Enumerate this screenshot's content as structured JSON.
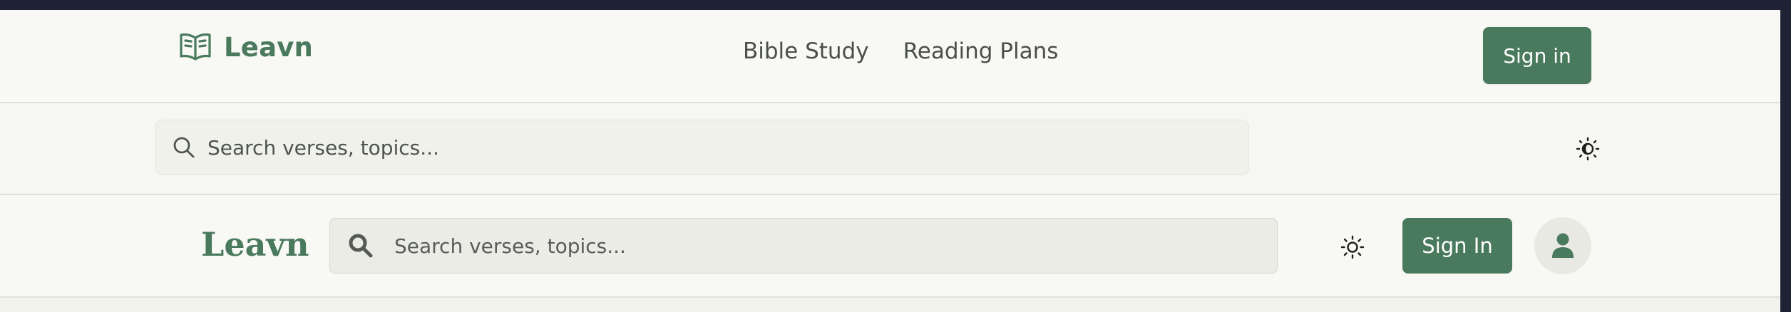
{
  "header": {
    "brand_name": "Leavn",
    "brand_icon": "open-book-icon",
    "nav": [
      {
        "label": "Bible Study"
      },
      {
        "label": "Reading Plans"
      }
    ],
    "sign_in_label": "Sign in"
  },
  "search_bar": {
    "placeholder": "Search verses, topics...",
    "icon": "search-icon",
    "theme_toggle_icon": "sun-moon-icon"
  },
  "alt_header": {
    "brand_name": "Leavn",
    "search_placeholder": "Search verses, topics...",
    "search_icon": "search-icon",
    "theme_toggle_icon": "sun-icon",
    "sign_in_label": "Sign In",
    "avatar_icon": "user-icon"
  },
  "colors": {
    "accent": "#4a7a5e",
    "background": "#f8f8f4",
    "frame": "#1f2335"
  }
}
